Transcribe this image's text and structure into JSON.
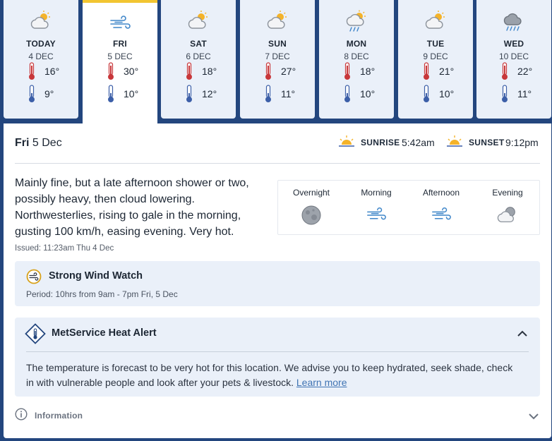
{
  "days": [
    {
      "name": "TODAY",
      "date": "4 DEC",
      "high": "16°",
      "low": "9°",
      "icon": "partly-cloudy-icon"
    },
    {
      "name": "FRI",
      "date": "5 DEC",
      "high": "30°",
      "low": "10°",
      "icon": "wind-icon",
      "selected": true
    },
    {
      "name": "SAT",
      "date": "6 DEC",
      "high": "18°",
      "low": "12°",
      "icon": "partly-cloudy-icon"
    },
    {
      "name": "SUN",
      "date": "7 DEC",
      "high": "27°",
      "low": "11°",
      "icon": "partly-cloudy-icon"
    },
    {
      "name": "MON",
      "date": "8 DEC",
      "high": "18°",
      "low": "10°",
      "icon": "sun-showers-icon"
    },
    {
      "name": "TUE",
      "date": "9 DEC",
      "high": "21°",
      "low": "10°",
      "icon": "partly-cloudy-icon"
    },
    {
      "name": "WED",
      "date": "10 DEC",
      "high": "22°",
      "low": "11°",
      "icon": "rain-icon"
    }
  ],
  "detail": {
    "day": "Fri",
    "date": "5 Dec",
    "sunrise_label": "SUNRISE",
    "sunrise": "5:42am",
    "sunset_label": "SUNSET",
    "sunset": "9:12pm",
    "description": "Mainly fine, but a late afternoon shower or two, possibly heavy, then cloud lowering. Northwesterlies, rising to gale in the morning, gusting 100 km/h, easing evening. Very hot.",
    "issued": "Issued: 11:23am Thu 4 Dec",
    "periods": [
      {
        "label": "Overnight",
        "icon": "moon-icon"
      },
      {
        "label": "Morning",
        "icon": "wind-icon"
      },
      {
        "label": "Afternoon",
        "icon": "wind-icon"
      },
      {
        "label": "Evening",
        "icon": "partly-cloudy-night-icon"
      }
    ]
  },
  "watch": {
    "title": "Strong Wind Watch",
    "period": "Period: 10hrs from 9am - 7pm Fri, 5 Dec"
  },
  "alert": {
    "title": "MetService Heat Alert",
    "body": "The temperature is forecast to be very hot for this location. We advise you to keep hydrated, seek shade, check in with vulnerable people and look after your pets & livestock.",
    "link": "Learn more"
  },
  "info": {
    "label": "Information"
  },
  "colors": {
    "background": "#23467e",
    "card": "#eaf0f9",
    "selected_accent": "#f2c531",
    "thermo_hot": "#c8373a",
    "thermo_cold": "#3c5fa8",
    "sun": "#f4b32a",
    "wind": "#3f86c9"
  }
}
